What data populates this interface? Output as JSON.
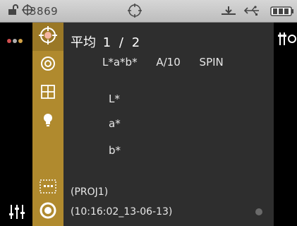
{
  "status_bar": {
    "device_id": "3869",
    "icons": [
      "unlock-icon",
      "crosshair-icon",
      "target-icon",
      "usb-icon",
      "usb-plug-icon",
      "battery-icon"
    ]
  },
  "left_column": {
    "dots": [
      {
        "name": "dot-red",
        "color": "#d35050"
      },
      {
        "name": "dot-gray",
        "color": "#b0b0b0"
      },
      {
        "name": "dot-orange",
        "color": "#d3a246"
      }
    ],
    "bottom_icon": "sliders-icon"
  },
  "mode_column": {
    "active_index": 0,
    "buttons": [
      {
        "icon": "target-icon"
      },
      {
        "icon": "measure-circle-icon"
      },
      {
        "icon": "grid-icon"
      },
      {
        "icon": "bulb-icon"
      },
      {
        "icon": "dotted-box-icon"
      },
      {
        "icon": "measure-ring-icon"
      }
    ]
  },
  "main": {
    "title": "平均",
    "page_current": "1",
    "page_separator": "/",
    "page_total": "2",
    "header": {
      "color_space": "L*a*b*",
      "illuminant_observer": "A/10",
      "mode": "SPIN"
    },
    "rows": [
      {
        "label": "L*"
      },
      {
        "label": "a*"
      },
      {
        "label": "b*"
      }
    ],
    "project": "(PROJ1)",
    "timestamp": "(10:16:02_13-06-13)"
  },
  "right_column": {
    "icon": "tools-icon"
  },
  "colors": {
    "mode_column": "#b08a2e",
    "main_bg": "#2e2e2e",
    "status_bar": "#cfcfcf"
  }
}
